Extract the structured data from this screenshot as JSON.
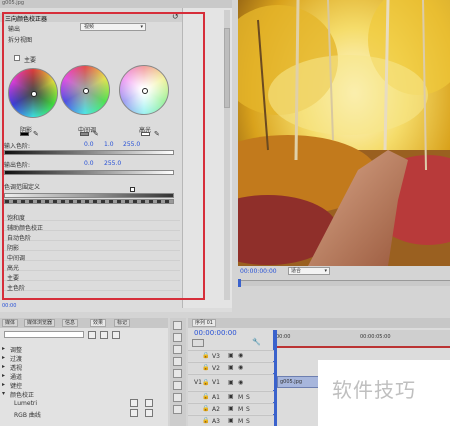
{
  "effect_controls": {
    "clip_name": "g005.jpg",
    "effect_title": "三向颜色校正器",
    "output_label": "输出",
    "output_value": "视频",
    "split_view_label": "拆分视图",
    "main_label": "主要",
    "wheel_labels": [
      "阴影",
      "中间调",
      "高光"
    ],
    "input_levels_label": "输入色阶:",
    "input_levels_values": [
      "0.0",
      "1.0",
      "255.0"
    ],
    "output_levels_label": "输出色阶:",
    "output_levels_values": [
      "0.0",
      "255.0"
    ],
    "tonal_range_label": "色调范围定义",
    "rows": [
      "饱和度",
      "辅助颜色校正",
      "自动色阶",
      "阴影",
      "中间调",
      "高光",
      "主要",
      "主色阶"
    ],
    "timecode": "00:00"
  },
  "program_monitor": {
    "timecode": "00:00:00:00",
    "fit_option": "适合"
  },
  "bottom_tabs": {
    "labels": [
      "媒体",
      "媒体浏览器",
      "信息",
      "效果",
      "标记"
    ]
  },
  "effects_list": {
    "items": [
      "调整",
      "过渡",
      "透视",
      "通道",
      "键控",
      "颜色校正",
      "Lumetri",
      "RGB 曲线"
    ]
  },
  "timeline": {
    "tab_label": "序列 01",
    "timecode": "00:00:00:00",
    "ruler_labels": [
      "00:00",
      "00:00:05:00"
    ],
    "tracks": [
      "V3",
      "V2",
      "V1",
      "A1",
      "A2",
      "A3"
    ],
    "clip_name": "g005.jpg",
    "mute_labels": [
      "M",
      "M",
      "M"
    ],
    "solo_labels": [
      "S",
      "S",
      "S"
    ]
  },
  "watermark": "软件技巧",
  "colors": {
    "highlight_box": "#d62e3a",
    "timecode_blue": "#2650d6",
    "playhead": "#d02020",
    "clip": "#a7b6dc"
  }
}
